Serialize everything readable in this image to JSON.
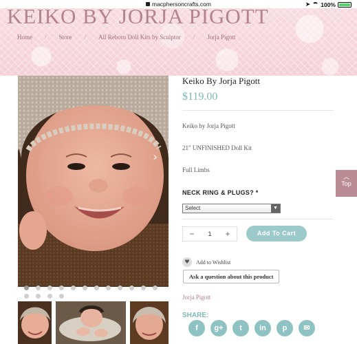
{
  "status_bar": {
    "url": "macphersoncrafts.com",
    "battery": "100%"
  },
  "header": {
    "site_title": "KEIKO BY JORJA PIGOTT",
    "breadcrumb": [
      "Home",
      "Store",
      "All Reborn Doll Kits by Sculptor",
      "Jorja Pigott"
    ]
  },
  "product": {
    "title": "Keiko By Jorja Pigott",
    "price": "$119.00",
    "description": [
      "Keiko by Jorja Pigott",
      "21\" UNFINISHED Doll Kit",
      "Full Limbs"
    ],
    "option_label": "NECK RING & PLUGS? *",
    "option_selected": "Select",
    "quantity": "1",
    "add_to_cart": "Add To Cart",
    "wishlist": "Add to Wishlist",
    "ask_question": "Ask a question about this product",
    "sculptor_link": "Jorja Pigott",
    "share_label": "SHARE:",
    "social_icons": [
      "facebook-icon",
      "google-plus-icon",
      "twitter-icon",
      "linkedin-icon",
      "pinterest-icon",
      "email-icon"
    ]
  },
  "gallery": {
    "dot_count": 16,
    "active_dot": 0
  },
  "back_to_top": "Top",
  "colors": {
    "accent": "#8fc3c3",
    "price": "#7fb8b8",
    "banner": "#f4d0d7",
    "top_button": "#b98c95"
  }
}
